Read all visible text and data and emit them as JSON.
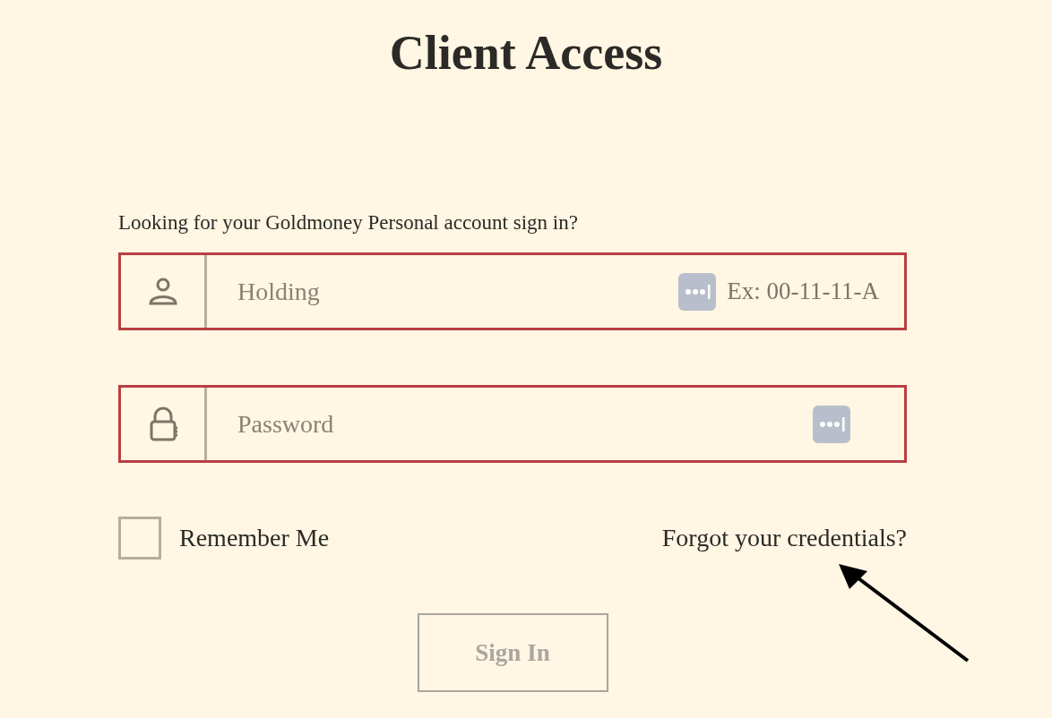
{
  "title": "Client Access",
  "notice": "Looking for your Goldmoney Personal account sign in?",
  "fields": [
    {
      "kind": "user",
      "placeholder": "Holding",
      "hint": "Ex: 00-11-11-A",
      "error": true
    },
    {
      "kind": "password",
      "placeholder": "Password",
      "error": true
    }
  ],
  "remember": {
    "label": "Remember Me",
    "checked": false
  },
  "forgot_link": "Forgot your credentials?",
  "submit": {
    "label": "Sign In",
    "disabled": true
  }
}
